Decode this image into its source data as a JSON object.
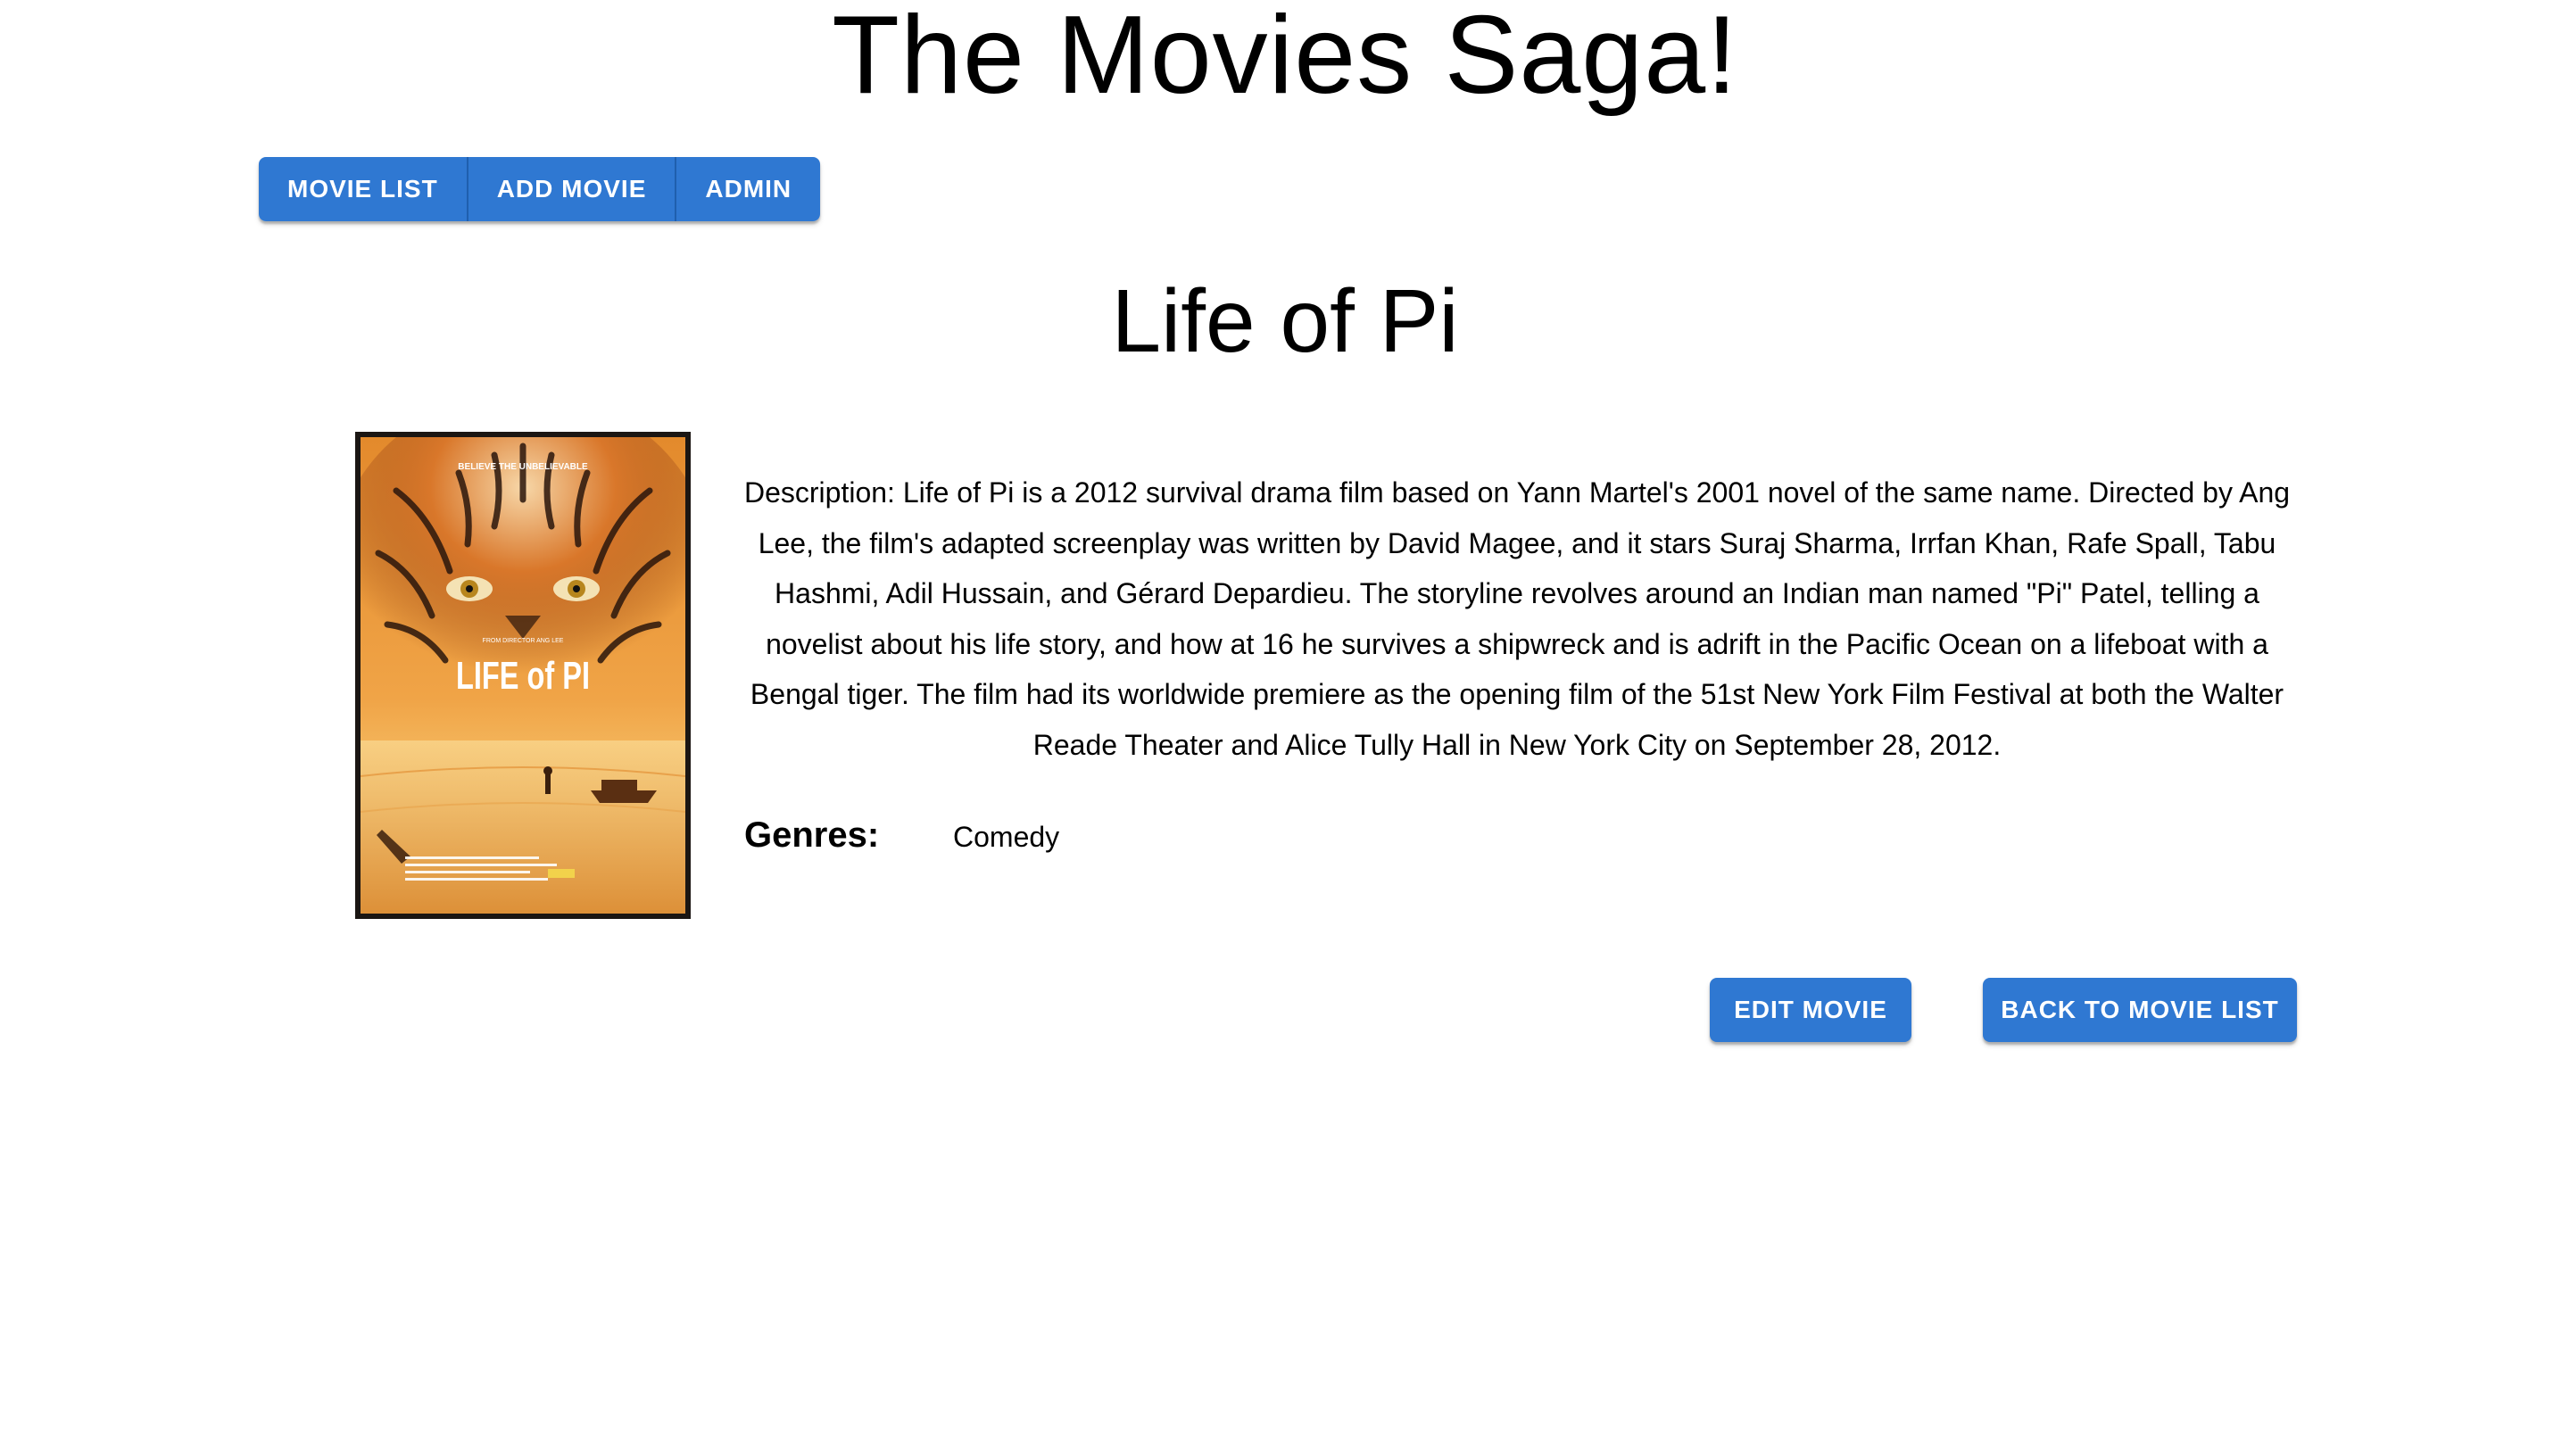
{
  "app": {
    "title": "The Movies Saga!"
  },
  "nav": {
    "items": [
      {
        "label": "MOVIE LIST"
      },
      {
        "label": "ADD MOVIE"
      },
      {
        "label": "ADMIN"
      }
    ]
  },
  "movie": {
    "title": "Life of Pi",
    "poster": {
      "tagline": "BELIEVE THE UNBELIEVABLE",
      "director_credit": "FROM DIRECTOR ANG LEE",
      "title_text": "LIFE of PI",
      "alt": "Life of Pi poster"
    },
    "description": "Description: Life of Pi is a 2012 survival drama film based on Yann Martel's 2001 novel of the same name. Directed by Ang Lee, the film's adapted screenplay was written by David Magee, and it stars Suraj Sharma, Irrfan Khan, Rafe Spall, Tabu Hashmi, Adil Hussain, and Gérard Depardieu. The storyline revolves around an Indian man named \"Pi\" Patel, telling a novelist about his life story, and how at 16 he survives a shipwreck and is adrift in the Pacific Ocean on a lifeboat with a Bengal tiger. The film had its worldwide premiere as the opening film of the 51st New York Film Festival at both the Walter Reade Theater and Alice Tully Hall in New York City on September 28, 2012.",
    "genres_label": "Genres:",
    "genres": [
      "Comedy"
    ]
  },
  "actions": {
    "edit_label": "EDIT MOVIE",
    "back_label": "BACK TO MOVIE LIST"
  },
  "colors": {
    "accent": "#2f78d2",
    "text": "#000000",
    "background": "#ffffff"
  }
}
